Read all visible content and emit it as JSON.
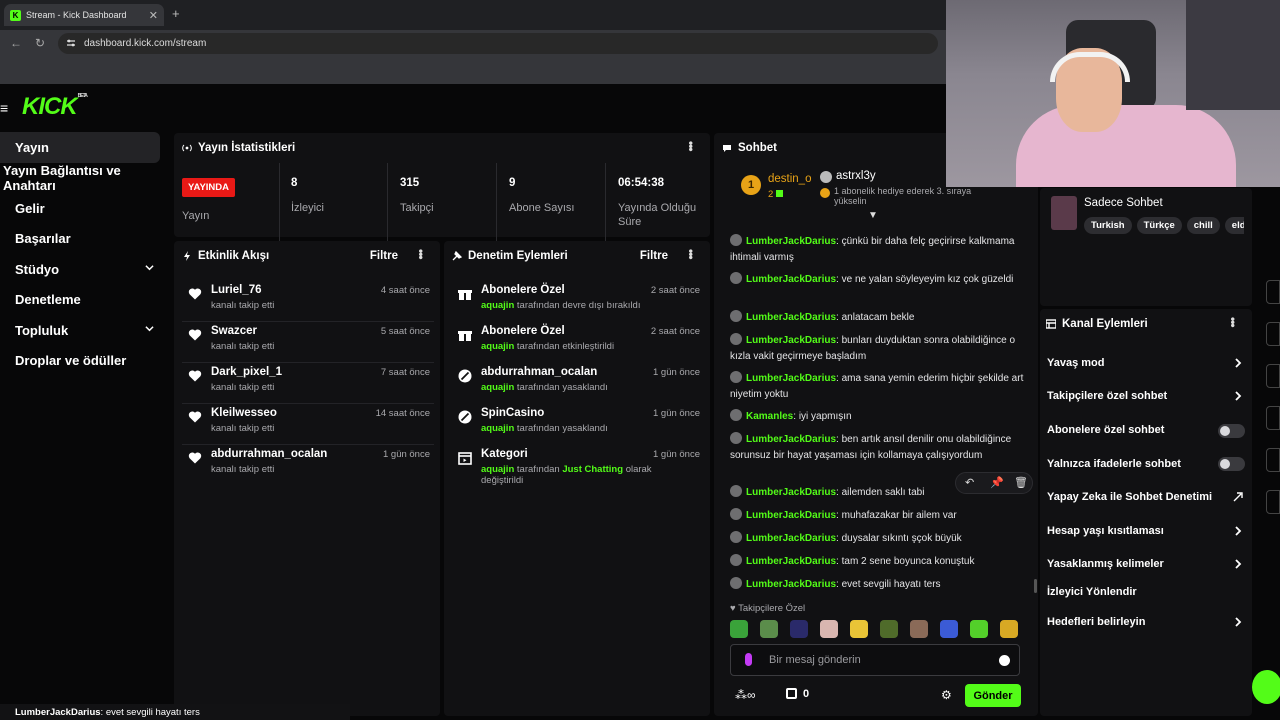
{
  "browser": {
    "tab_title": "Stream - Kick Dashboard",
    "tab_favicon": "K",
    "url": "dashboard.kick.com/stream"
  },
  "brand": {
    "logo": "KICK",
    "badge": "BETA",
    "accent": "#53fc18"
  },
  "sidebar": {
    "items": [
      {
        "label": "Yayın",
        "active": true
      },
      {
        "label": "Yayın Bağlantısı ve Anahtarı"
      },
      {
        "label": "Gelir"
      },
      {
        "label": "Başarılar"
      },
      {
        "label": "Stüdyo",
        "expandable": true
      },
      {
        "label": "Denetleme"
      },
      {
        "label": "Topluluk",
        "expandable": true
      },
      {
        "label": "Droplar ve ödüller"
      }
    ]
  },
  "stats": {
    "title": "Yayın İstatistikleri",
    "live_label": "YAYINDA",
    "status_label": "Yayın",
    "items": [
      {
        "value": "8",
        "label": "İzleyici"
      },
      {
        "value": "315",
        "label": "Takipçi"
      },
      {
        "value": "9",
        "label": "Abone Sayısı"
      },
      {
        "value": "06:54:38",
        "label": "Yayında Olduğu Süre"
      }
    ]
  },
  "activity": {
    "title": "Etkinlik Akışı",
    "filter": "Filtre",
    "items": [
      {
        "name": "Luriel_76",
        "sub": "kanalı takip etti",
        "time": "4 saat önce"
      },
      {
        "name": "Swazcer",
        "sub": "kanalı takip etti",
        "time": "5 saat önce"
      },
      {
        "name": "Dark_pixel_1",
        "sub": "kanalı takip etti",
        "time": "7 saat önce"
      },
      {
        "name": "Kleilwesseo",
        "sub": "kanalı takip etti",
        "time": "14 saat önce"
      },
      {
        "name": "abdurrahman_ocalan",
        "sub": "kanalı takip etti",
        "time": "1 gün önce"
      }
    ]
  },
  "moderation": {
    "title": "Denetim Eylemleri",
    "filter": "Filtre",
    "items": [
      {
        "name": "Abonelere Özel",
        "actor": "aquajin",
        "sub": "tarafından devre dışı bırakıldı",
        "time": "2 saat önce",
        "icon": "gift-icon"
      },
      {
        "name": "Abonelere Özel",
        "actor": "aquajin",
        "sub": "tarafından etkinleştirildi",
        "time": "2 saat önce",
        "icon": "gift-icon"
      },
      {
        "name": "abdurrahman_ocalan",
        "actor": "aquajin",
        "sub": "tarafından yasaklandı",
        "time": "1 gün önce",
        "icon": "ban-icon"
      },
      {
        "name": "SpinCasino",
        "actor": "aquajin",
        "sub": "tarafından yasaklandı",
        "time": "1 gün önce",
        "icon": "ban-icon"
      },
      {
        "name": "Kategori",
        "actor": "aquajin",
        "sub_pre": "tarafından",
        "highlight": "Just Chatting",
        "sub_post": "olarak",
        "sub_line2": "değiştirildi",
        "time": "1 gün önce",
        "icon": "category-icon"
      }
    ]
  },
  "chat": {
    "title": "Sohbet",
    "pinned_user": "destin_o",
    "pinned_rank": "1",
    "pinned_count": "2",
    "gift_user": "astrxl3y",
    "gift_text": "1 abonelik hediye ederek 3. sıraya yükselin",
    "messages": [
      {
        "user": "LumberJackDarius",
        "text": "çünkü bir daha felç geçirirse kalkmama ihtimali varmış"
      },
      {
        "user": "LumberJackDarius",
        "text": "ve ne yalan söyleyeyim kız çok güzeldi"
      },
      {
        "user": "LumberJackDarius",
        "text": "anlatacam bekle"
      },
      {
        "user": "LumberJackDarius",
        "text": "bunları duyduktan sonra olabildiğince o kızla vakit geçirmeye başladım"
      },
      {
        "user": "LumberJackDarius",
        "text": "ama sana yemin ederim hiçbir şekilde art niyetim yoktu"
      },
      {
        "user": "Kamanles",
        "text": "iyi yapmışın"
      },
      {
        "user": "LumberJackDarius",
        "text": "ben artık ansıl denilir onu olabildiğince sorunsuz bir hayat yaşaması için kollamaya çalışıyordum"
      },
      {
        "user": "LumberJackDarius",
        "text": "ailemden saklı tabi"
      },
      {
        "user": "LumberJackDarius",
        "text": "muhafazakar bir ailem var"
      },
      {
        "user": "LumberJackDarius",
        "text": "duysalar sıkıntı şçok büyük"
      },
      {
        "user": "LumberJackDarius",
        "text": "tam 2 sene boyunca konuştuk"
      },
      {
        "user": "LumberJackDarius",
        "text": "evet sevgili hayatı ters"
      }
    ],
    "followers_only": "Takipçilere Özel",
    "input_placeholder": "Bir mesaj gönderin",
    "viewer_count": "0",
    "send_label": "Gönder"
  },
  "stream_info": {
    "title": "Sadece Sohbet",
    "tags": [
      "Turkish",
      "Türkçe",
      "chill",
      "elde"
    ]
  },
  "channel_actions": {
    "title": "Kanal Eylemleri",
    "items": [
      {
        "label": "Yavaş mod",
        "control": "arrow"
      },
      {
        "label": "Takipçilere özel sohbet",
        "control": "arrow"
      },
      {
        "label": "Abonelere özel sohbet",
        "control": "toggle"
      },
      {
        "label": "Yalnızca ifadelerle sohbet",
        "control": "toggle"
      },
      {
        "label": "Yapay Zeka ile Sohbet Denetimi",
        "control": "external"
      },
      {
        "label": "Hesap yaşı kısıtlaması",
        "control": "arrow"
      },
      {
        "label": "Yasaklanmış kelimeler",
        "control": "arrow"
      },
      {
        "label": "İzleyici Yönlendir",
        "control": "none"
      },
      {
        "label": "Hedefleri belirleyin",
        "control": "arrow"
      }
    ]
  },
  "overlay_caption": {
    "user": "LumberJackDarius",
    "text": ": evet sevgili hayatı ters"
  }
}
